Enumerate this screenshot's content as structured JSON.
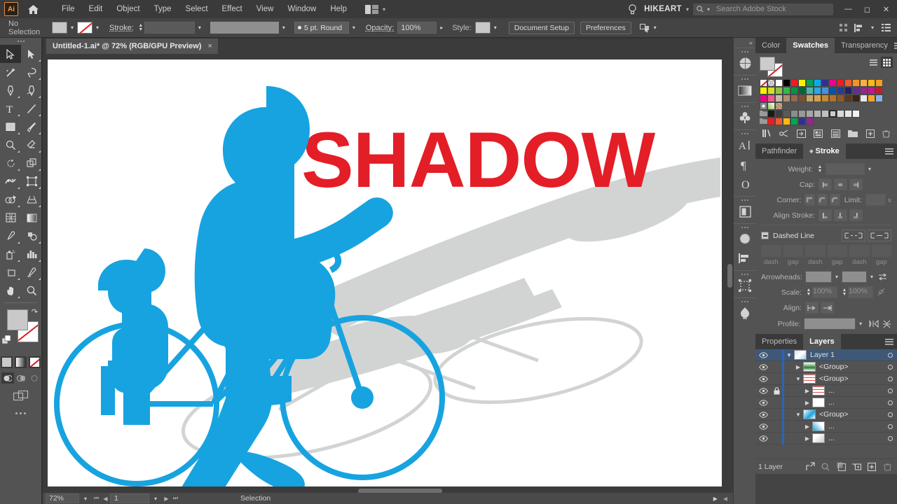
{
  "app": {
    "name": "Adobe Illustrator",
    "logo_text": "Ai",
    "user": "HIKEART"
  },
  "menubar": {
    "items": [
      "File",
      "Edit",
      "Object",
      "Type",
      "Select",
      "Effect",
      "View",
      "Window",
      "Help"
    ],
    "arrange_documents_tooltip": "Arrange Documents",
    "search_placeholder": "Search Adobe Stock",
    "window_buttons": [
      "minimize",
      "maximize",
      "close"
    ]
  },
  "controlbar": {
    "selection_status": "No Selection",
    "fill_label": "Fill",
    "stroke_label": "Stroke:",
    "stroke_weight_value": "",
    "variable_width_value": "",
    "brush_definition": "5 pt. Round",
    "opacity_label": "Opacity:",
    "opacity_value": "100%",
    "style_label": "Style:",
    "document_setup": "Document Setup",
    "preferences": "Preferences"
  },
  "tabs": {
    "document": "Untitled-1.ai* @ 72% (RGB/GPU Preview)",
    "close_glyph": "×"
  },
  "toolbar": {
    "tools": [
      {
        "name": "selection-tool",
        "selected": true
      },
      {
        "name": "direct-selection-tool",
        "selected": false
      },
      {
        "name": "magic-wand-tool",
        "selected": false
      },
      {
        "name": "lasso-tool",
        "selected": false
      },
      {
        "name": "pen-tool",
        "selected": false
      },
      {
        "name": "curvature-tool",
        "selected": false
      },
      {
        "name": "type-tool",
        "selected": false
      },
      {
        "name": "line-segment-tool",
        "selected": false
      },
      {
        "name": "rectangle-tool",
        "selected": false
      },
      {
        "name": "paintbrush-tool",
        "selected": false
      },
      {
        "name": "shaper-tool",
        "selected": false
      },
      {
        "name": "eraser-tool",
        "selected": false
      },
      {
        "name": "rotate-tool",
        "selected": false
      },
      {
        "name": "scale-tool",
        "selected": false
      },
      {
        "name": "width-tool",
        "selected": false
      },
      {
        "name": "free-transform-tool",
        "selected": false
      },
      {
        "name": "shape-builder-tool",
        "selected": false
      },
      {
        "name": "perspective-grid-tool",
        "selected": false
      },
      {
        "name": "mesh-tool",
        "selected": false
      },
      {
        "name": "gradient-tool",
        "selected": false
      },
      {
        "name": "eyedropper-tool",
        "selected": false
      },
      {
        "name": "blend-tool",
        "selected": false
      },
      {
        "name": "symbol-sprayer-tool",
        "selected": false
      },
      {
        "name": "column-graph-tool",
        "selected": false
      },
      {
        "name": "artboard-tool",
        "selected": false
      },
      {
        "name": "slice-tool",
        "selected": false
      },
      {
        "name": "hand-tool",
        "selected": false
      },
      {
        "name": "zoom-tool",
        "selected": false
      }
    ],
    "fill_color": "#c9c9c9",
    "stroke_color": "none",
    "color_modes": [
      "color",
      "gradient",
      "none"
    ],
    "draw_modes": [
      "draw-normal",
      "draw-behind",
      "draw-inside"
    ],
    "screen_mode": "change-screen-mode"
  },
  "artwork": {
    "headline": "SHADOW",
    "headline_color": "#e41e26",
    "figure_color": "#17a3e0",
    "shadow_color": "#d2d4d4",
    "background": "#ffffff"
  },
  "statusbar": {
    "zoom": "72%",
    "page": "1",
    "tool_status": "Selection"
  },
  "icondock": {
    "items": [
      "color-guide-icon",
      "gradient-icon",
      "symbols-icon",
      "character-icon",
      "paragraph-icon",
      "glyphs-icon",
      "artboards-icon",
      "brushes-icon",
      "align-icon",
      "transform-icon",
      "image-trace-icon"
    ],
    "expand_glyph": "«"
  },
  "swatches_panel": {
    "tabs": [
      "Color",
      "Swatches",
      "Transparency"
    ],
    "active_tab": "Swatches",
    "view_buttons": [
      "list-view",
      "grid-view"
    ],
    "active_view": "grid-view",
    "rows": [
      [
        "none",
        "registration",
        "#ffffff",
        "#000000",
        "#ed1c24",
        "#fff200",
        "#00a651",
        "#00aeef",
        "#2e3192",
        "#ec008c",
        "#ed1c24",
        "#f15a29",
        "#f7941e",
        "#fbb040",
        "#fdb913",
        "#f99d1c"
      ],
      [
        "#fff200",
        "#d7df23",
        "#8dc63f",
        "#39b54a",
        "#009444",
        "#006838",
        "#4db6ac",
        "#27aae1",
        "#4a90d9",
        "#0054a6",
        "#2b3990",
        "#262262",
        "#662d91",
        "#92278f",
        "#c4168d",
        "#bf1e2e"
      ],
      [
        "#ec008c",
        "#f0588f",
        "#c9b8a8",
        "#b08d6e",
        "#96694a",
        "#7a5230",
        "#c8a56a",
        "#d4a24c",
        "#c88a2e",
        "#b5702a",
        "#8c5a28",
        "#5c3a1e",
        "#3a2415",
        "#e8e8e8",
        "#f5a623",
        "#8ab4e8"
      ],
      [
        "pattern-dots",
        "pattern-leaf",
        "pattern-texture"
      ],
      [
        "folder",
        "#1a1a1a",
        "#3d3d3d",
        "#5a5a5a",
        "#8c8c8c",
        "#999999",
        "#a6a6a6",
        "#b3b3b3",
        "#c0c0c0",
        "#cccccc",
        "#d9d9d9",
        "#e6e6e6",
        "#f2f2f2"
      ],
      [
        "folder",
        "#ed1c24",
        "#f15a29",
        "#fdb913",
        "#00a651",
        "#2e3192",
        "#92278f"
      ]
    ],
    "tool_icons": [
      "swatch-libraries-menu",
      "color-group-link",
      "show-swatch-kinds-menu",
      "swatch-options",
      "new-color-group",
      "new-swatch-folder",
      "new-swatch",
      "delete-swatch"
    ]
  },
  "stroke_panel": {
    "tabs": [
      "Pathfinder",
      "Stroke"
    ],
    "active_tab": "Stroke",
    "weight_label": "Weight:",
    "weight_value": "",
    "cap_label": "Cap:",
    "corner_label": "Corner:",
    "limit_label": "Limit:",
    "limit_value": "",
    "limit_unit": "x",
    "align_stroke_label": "Align Stroke:",
    "dashed_line_label": "Dashed Line",
    "dash_labels": [
      "dash",
      "gap",
      "dash",
      "gap",
      "dash",
      "gap"
    ],
    "arrowheads_label": "Arrowheads:",
    "scale_label": "Scale:",
    "scale_value_1": "100%",
    "scale_value_2": "100%",
    "align_label": "Align:",
    "profile_label": "Profile:"
  },
  "layers_panel": {
    "tabs": [
      "Properties",
      "Layers"
    ],
    "active_tab": "Layers",
    "rows": [
      {
        "name": "Layer 1",
        "indent": 0,
        "expanded": true,
        "locked": false,
        "selected": true,
        "thumb": "artwork",
        "has_disclosure": true
      },
      {
        "name": "<Group>",
        "indent": 1,
        "expanded": false,
        "locked": false,
        "selected": false,
        "thumb": "tree",
        "has_disclosure": true
      },
      {
        "name": "<Group>",
        "indent": 1,
        "expanded": true,
        "locked": false,
        "selected": false,
        "thumb": "lines",
        "has_disclosure": true
      },
      {
        "name": "...",
        "indent": 2,
        "expanded": false,
        "locked": true,
        "selected": false,
        "thumb": "lines",
        "has_disclosure": true
      },
      {
        "name": "...",
        "indent": 2,
        "expanded": false,
        "locked": false,
        "selected": false,
        "thumb": "white",
        "has_disclosure": true
      },
      {
        "name": "<Group>",
        "indent": 1,
        "expanded": true,
        "locked": false,
        "selected": false,
        "thumb": "blue",
        "has_disclosure": true
      },
      {
        "name": "...",
        "indent": 2,
        "expanded": false,
        "locked": false,
        "selected": false,
        "thumb": "blue2",
        "has_disclosure": true
      },
      {
        "name": "...",
        "indent": 2,
        "expanded": false,
        "locked": false,
        "selected": false,
        "thumb": "grey",
        "has_disclosure": true
      }
    ],
    "footer_count": "1 Layer",
    "footer_buttons": [
      "locate-object",
      "search-layer",
      "make-clipping-mask",
      "create-new-sublayer",
      "create-new-layer",
      "delete-selection"
    ]
  }
}
